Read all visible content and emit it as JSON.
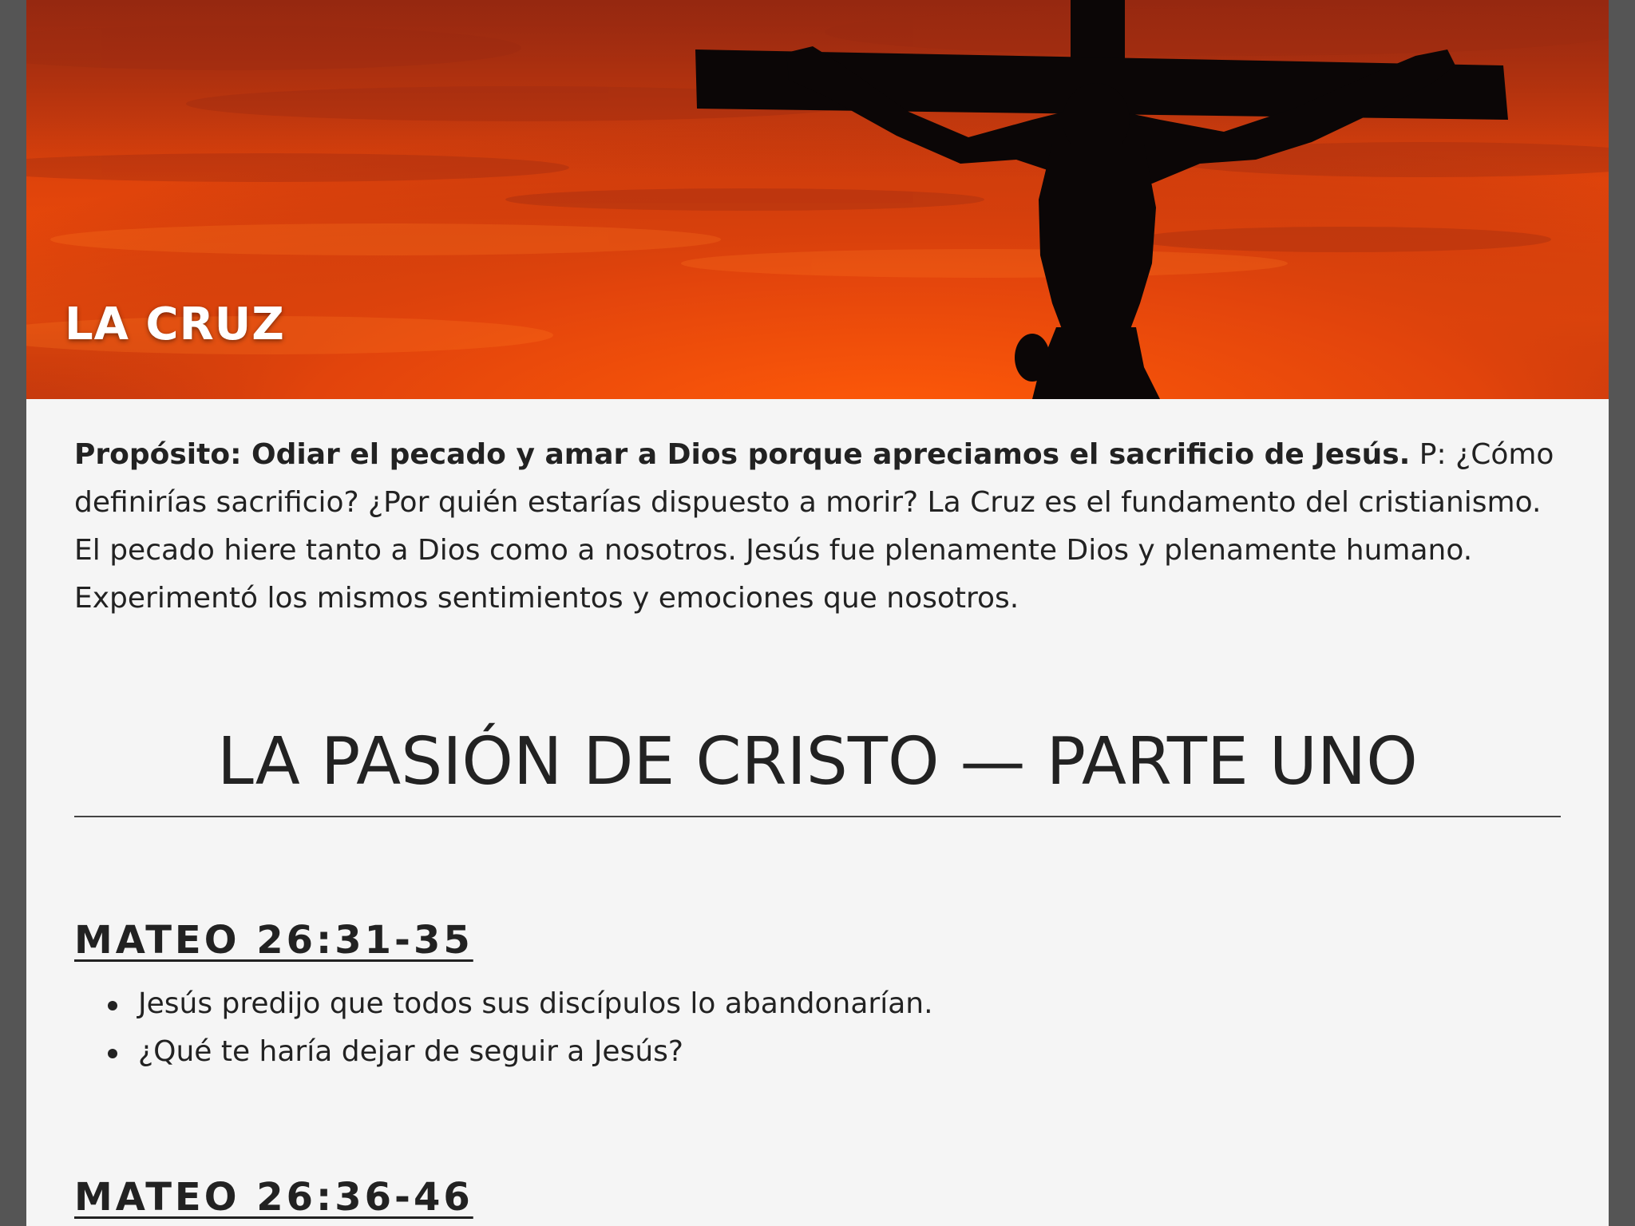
{
  "hero": {
    "title": "LA CRUZ",
    "image": "sunset-crucifix-silhouette"
  },
  "intro": {
    "purpose": "Propósito: Odiar el pecado y amar a Dios porque apreciamos el sacrificio de Jesús.",
    "body": " P: ¿Cómo definirías sacrificio? ¿Por quién estarías dispuesto a morir? La Cruz es el fundamento del cristianismo. El pecado hiere tanto a Dios como a nosotros. Jesús fue plenamente Dios y plenamente humano. Experimentó los mismos sentimientos y emociones que nosotros."
  },
  "section": {
    "title": "LA PASIÓN DE CRISTO — PARTE UNO"
  },
  "passages": [
    {
      "reference": "MATEO 26:31-35",
      "points": [
        "Jesús predijo que todos sus discípulos lo abandonarían.",
        "¿Qué te haría dejar de seguir a Jesús?"
      ]
    },
    {
      "reference": "MATEO 26:36-46",
      "points": []
    }
  ],
  "colors": {
    "page_background": "#f5f5f5",
    "outer_background": "#555555",
    "text": "#222222",
    "sky": "#e8480a"
  }
}
